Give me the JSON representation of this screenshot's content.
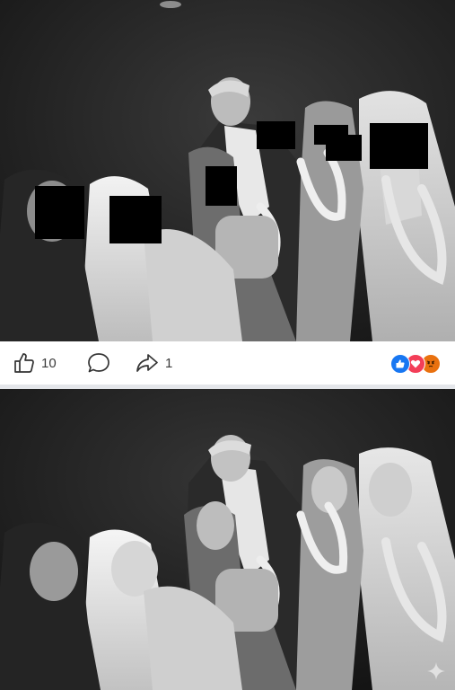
{
  "post_top": {
    "image_description_icon": "photo-redacted",
    "actions": {
      "like_icon": "thumbs-up-icon",
      "like_count": "10",
      "comment_icon": "speech-bubble-icon",
      "share_icon": "share-arrow-icon",
      "share_count": "1"
    },
    "reactions": [
      {
        "name": "like-reaction",
        "color": "#1877f2"
      },
      {
        "name": "love-reaction",
        "color": "#f33e58"
      },
      {
        "name": "angry-reaction",
        "color": "#e9710f"
      }
    ]
  },
  "post_bottom": {
    "watermark_icon": "sparkle-icon"
  },
  "colors": {
    "redaction": "#000000",
    "separator": "#e4e6ea"
  }
}
